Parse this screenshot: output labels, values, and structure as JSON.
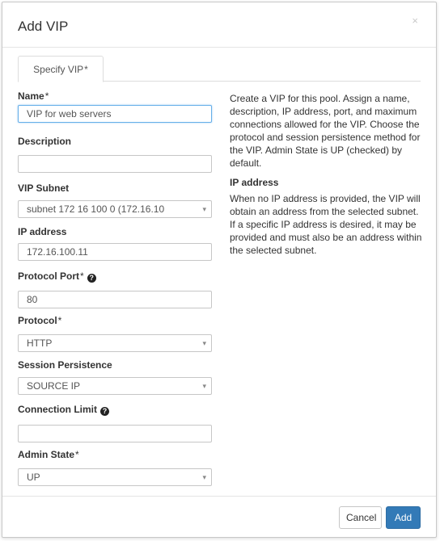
{
  "modal": {
    "title": "Add VIP",
    "close_glyph": "×"
  },
  "tabs": [
    {
      "label": "Specify VIP",
      "required_mark": "*"
    }
  ],
  "form": {
    "name": {
      "label": "Name",
      "required_mark": "*",
      "value": "VIP for web servers"
    },
    "description": {
      "label": "Description",
      "value": ""
    },
    "vip_subnet": {
      "label": "VIP Subnet",
      "value": "subnet_172_16_100_0 (172.16.10",
      "display": "subnet  172  16  100  0 (172.16.10"
    },
    "ip_address": {
      "label": "IP address",
      "value": "172.16.100.11"
    },
    "protocol_port": {
      "label": "Protocol Port",
      "required_mark": "*",
      "value": "80",
      "help_icon": "question-circle-icon"
    },
    "protocol": {
      "label": "Protocol",
      "required_mark": "*",
      "value": "HTTP"
    },
    "session_persistence": {
      "label": "Session Persistence",
      "value": "SOURCE_IP",
      "display": "SOURCE  IP"
    },
    "connection_limit": {
      "label": "Connection Limit",
      "value": "",
      "help_icon": "question-circle-icon"
    },
    "admin_state": {
      "label": "Admin State",
      "required_mark": "*",
      "value": "UP"
    }
  },
  "help": {
    "intro": "Create a VIP for this pool. Assign a name, description, IP address, port, and maximum connections allowed for the VIP. Choose the protocol and session persistence method for the VIP. Admin State is UP (checked) by default.",
    "ip_heading": "IP address",
    "ip_text": "When no IP address is provided, the VIP will obtain an address from the selected subnet. If a specific IP address is desired, it may be provided and must also be an address within the selected subnet."
  },
  "footer": {
    "cancel_label": "Cancel",
    "add_label": "Add"
  },
  "colors": {
    "primary": "#337ab7",
    "focus_border": "#66afe9"
  },
  "select_arrow_glyph": "▾",
  "help_glyph": "?"
}
